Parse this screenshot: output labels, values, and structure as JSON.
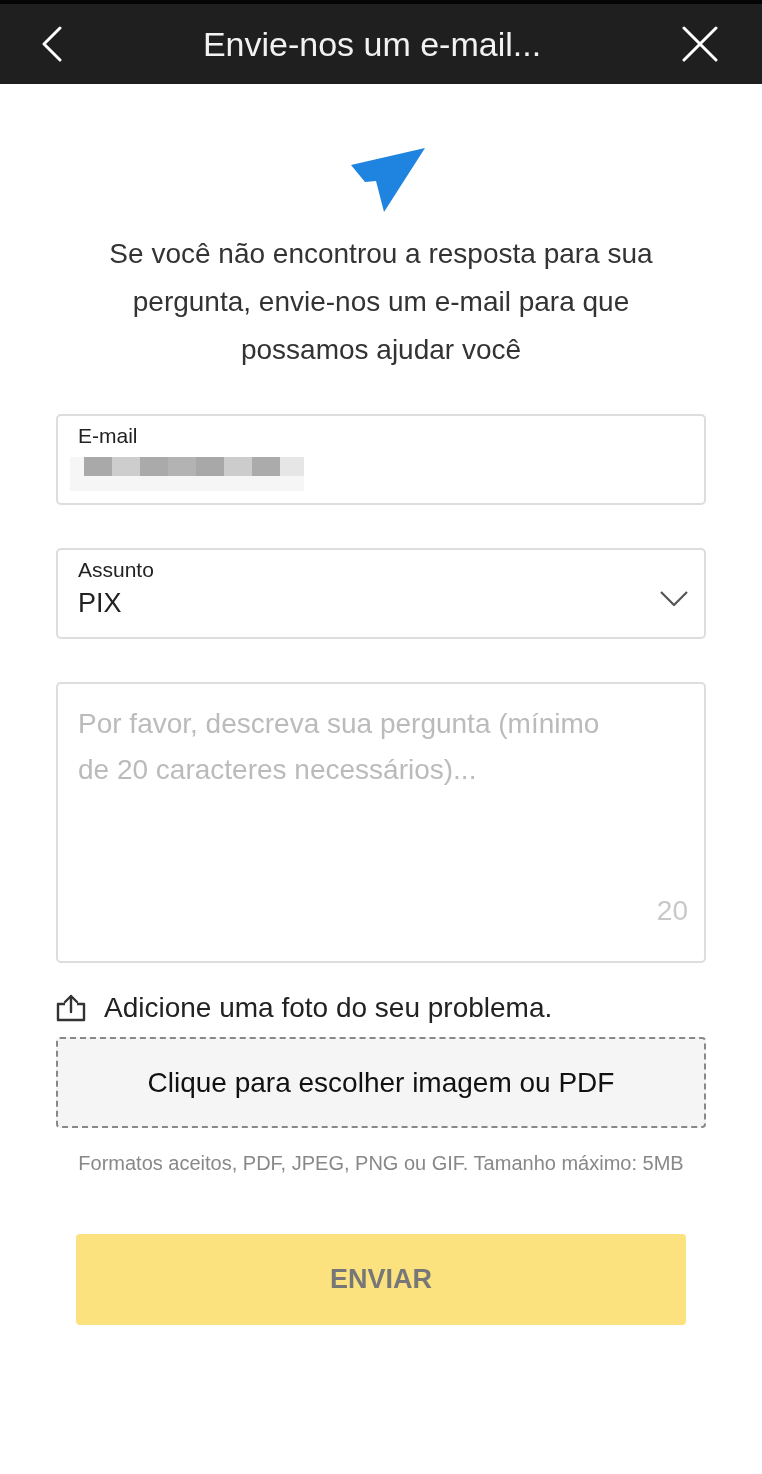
{
  "header": {
    "title": "Envie-nos um e-mail..."
  },
  "intro": "Se você não encontrou a resposta para sua pergunta, envie-nos um e-mail para que possamos ajudar você",
  "form": {
    "email": {
      "label": "E-mail",
      "redacted": true
    },
    "subject": {
      "label": "Assunto",
      "value": "PIX"
    },
    "description": {
      "placeholder": "Por favor, descreva sua pergunta (mínimo de 20 caracteres necessários)...",
      "counter": "20"
    }
  },
  "attachment": {
    "label": "Adicione uma foto do seu problema.",
    "button": "Clique para escolher imagem ou PDF",
    "hint": "Formatos aceitos, PDF, JPEG, PNG ou GIF. Tamanho máximo: 5MB"
  },
  "submit": {
    "label": "ENVIAR",
    "disabled": true
  }
}
